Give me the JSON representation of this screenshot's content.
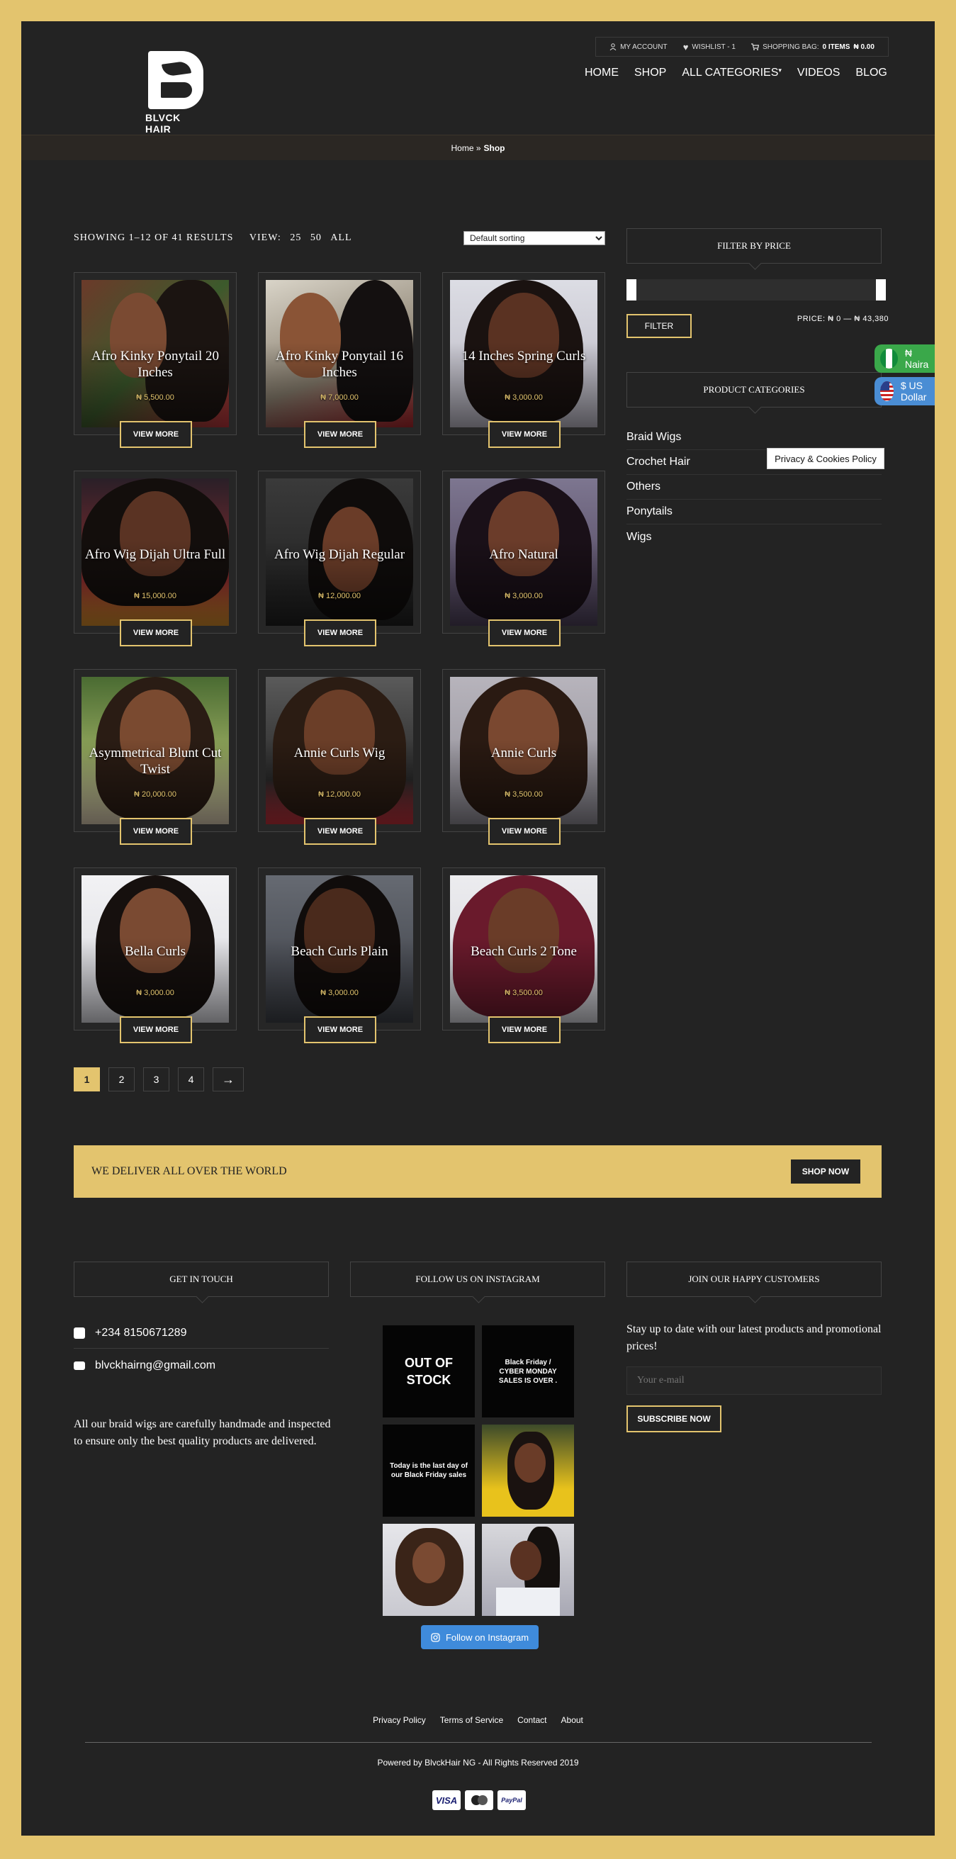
{
  "header": {
    "logo_text": "BLVCK HAIR",
    "topbar": {
      "my_account": "MY ACCOUNT",
      "wishlist": "WISHLIST - 1",
      "shopping_bag": "SHOPPING BAG:",
      "items": "0 ITEMS",
      "total": "₦ 0.00"
    },
    "nav": [
      "HOME",
      "SHOP",
      "ALL CATEGORIES",
      "VIDEOS",
      "BLOG"
    ]
  },
  "breadcrumb": {
    "home": "Home »",
    "current": "Shop"
  },
  "results": {
    "showing": "SHOWING 1–12 OF 41 RESULTS",
    "view_label": "VIEW:",
    "view_options": [
      "25",
      "50",
      "ALL"
    ],
    "sort_value": "Default sorting"
  },
  "products": [
    {
      "title": "Afro Kinky Ponytail 20 Inches",
      "price": "₦ 5,500.00",
      "button": "VIEW MORE"
    },
    {
      "title": "Afro Kinky Ponytail 16 Inches",
      "price": "₦ 7,000.00",
      "button": "VIEW MORE"
    },
    {
      "title": "14 Inches Spring Curls",
      "price": "₦ 3,000.00",
      "button": "VIEW MORE"
    },
    {
      "title": "Afro Wig Dijah Ultra Full",
      "price": "₦ 15,000.00",
      "button": "VIEW MORE"
    },
    {
      "title": "Afro Wig Dijah Regular",
      "price": "₦ 12,000.00",
      "button": "VIEW MORE"
    },
    {
      "title": "Afro Natural",
      "price": "₦ 3,000.00",
      "button": "VIEW MORE"
    },
    {
      "title": "Asymmetrical Blunt Cut Twist",
      "price": "₦ 20,000.00",
      "button": "VIEW MORE"
    },
    {
      "title": "Annie Curls Wig",
      "price": "₦ 12,000.00",
      "button": "VIEW MORE"
    },
    {
      "title": "Annie Curls",
      "price": "₦ 3,500.00",
      "button": "VIEW MORE"
    },
    {
      "title": "Bella Curls",
      "price": "₦ 3,000.00",
      "button": "VIEW MORE"
    },
    {
      "title": "Beach Curls Plain",
      "price": "₦ 3,000.00",
      "button": "VIEW MORE"
    },
    {
      "title": "Beach Curls 2 Tone",
      "price": "₦ 3,500.00",
      "button": "VIEW MORE"
    }
  ],
  "pagination": [
    "1",
    "2",
    "3",
    "4",
    "→"
  ],
  "sidebar": {
    "filter_title": "FILTER BY PRICE",
    "filter_button": "FILTER",
    "price_range": "PRICE: ₦ 0 — ₦ 43,380",
    "categories_title": "PRODUCT CATEGORIES",
    "categories": [
      "Braid Wigs",
      "Crochet Hair",
      "Others",
      "Ponytails",
      "Wigs"
    ],
    "privacy_popup": "Privacy & Cookies Policy"
  },
  "currency": {
    "ngn": "₦ Naira",
    "usd": "$ US Dollar"
  },
  "banner": {
    "text": "WE DELIVER ALL OVER THE WORLD",
    "button": "SHOP NOW"
  },
  "footer": {
    "get_in_touch_title": "GET IN TOUCH",
    "phone": "+234 8150671289",
    "email": "blvckhairng@gmail.com",
    "about": "All our braid wigs are carefully handmade and inspected to ensure only the best quality products are delivered.",
    "instagram_title": "FOLLOW US ON INSTAGRAM",
    "instagram_posts": [
      {
        "text": "OUT OF STOCK"
      },
      {
        "text": "Black Friday / CYBER MONDAY SALES IS OVER ."
      },
      {
        "text": "Today is the last day of our Black Friday sales"
      }
    ],
    "instagram_follow": "Follow on Instagram",
    "join_title": "JOIN OUR HAPPY CUSTOMERS",
    "join_text": "Stay up to date with our latest products and promotional prices!",
    "email_placeholder": "Your e-mail",
    "subscribe": "SUBSCRIBE NOW",
    "links": [
      "Privacy Policy",
      "Terms of Service",
      "Contact",
      "About"
    ],
    "powered": "Powered by BlvckHair NG - All Rights Reserved 2019",
    "payments": [
      "VISA",
      "PayPal"
    ]
  },
  "colors": {
    "gold": "#e3c46e",
    "background": "#232323",
    "instagram_blue": "#3f8bdb"
  }
}
